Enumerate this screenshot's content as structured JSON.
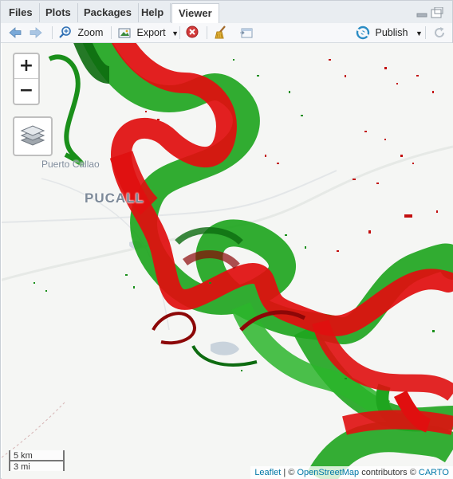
{
  "tabs": [
    {
      "label": "Files"
    },
    {
      "label": "Plots"
    },
    {
      "label": "Packages"
    },
    {
      "label": "Help"
    },
    {
      "label": "Viewer"
    }
  ],
  "toolbar": {
    "zoom_label": "Zoom",
    "export_label": "Export",
    "publish_label": "Publish"
  },
  "map": {
    "zoom_in": "+",
    "zoom_out": "−",
    "places": {
      "puerto_callao": "Puerto Callao",
      "pucallpa": "PUCALL"
    },
    "scale": {
      "metric": "5 km",
      "imperial": "3 mi"
    },
    "attribution": {
      "leaflet": "Leaflet",
      "sep1": " | © ",
      "osm": "OpenStreetMap",
      "contributors": " contributors © ",
      "carto": "CARTO"
    },
    "colors": {
      "green": "#1fa51f",
      "dark_green": "#0d6b10",
      "red": "#e00f0f",
      "dark_red": "#8c0707",
      "water": "#c9d3dc",
      "background": "#f5f6f4"
    }
  }
}
